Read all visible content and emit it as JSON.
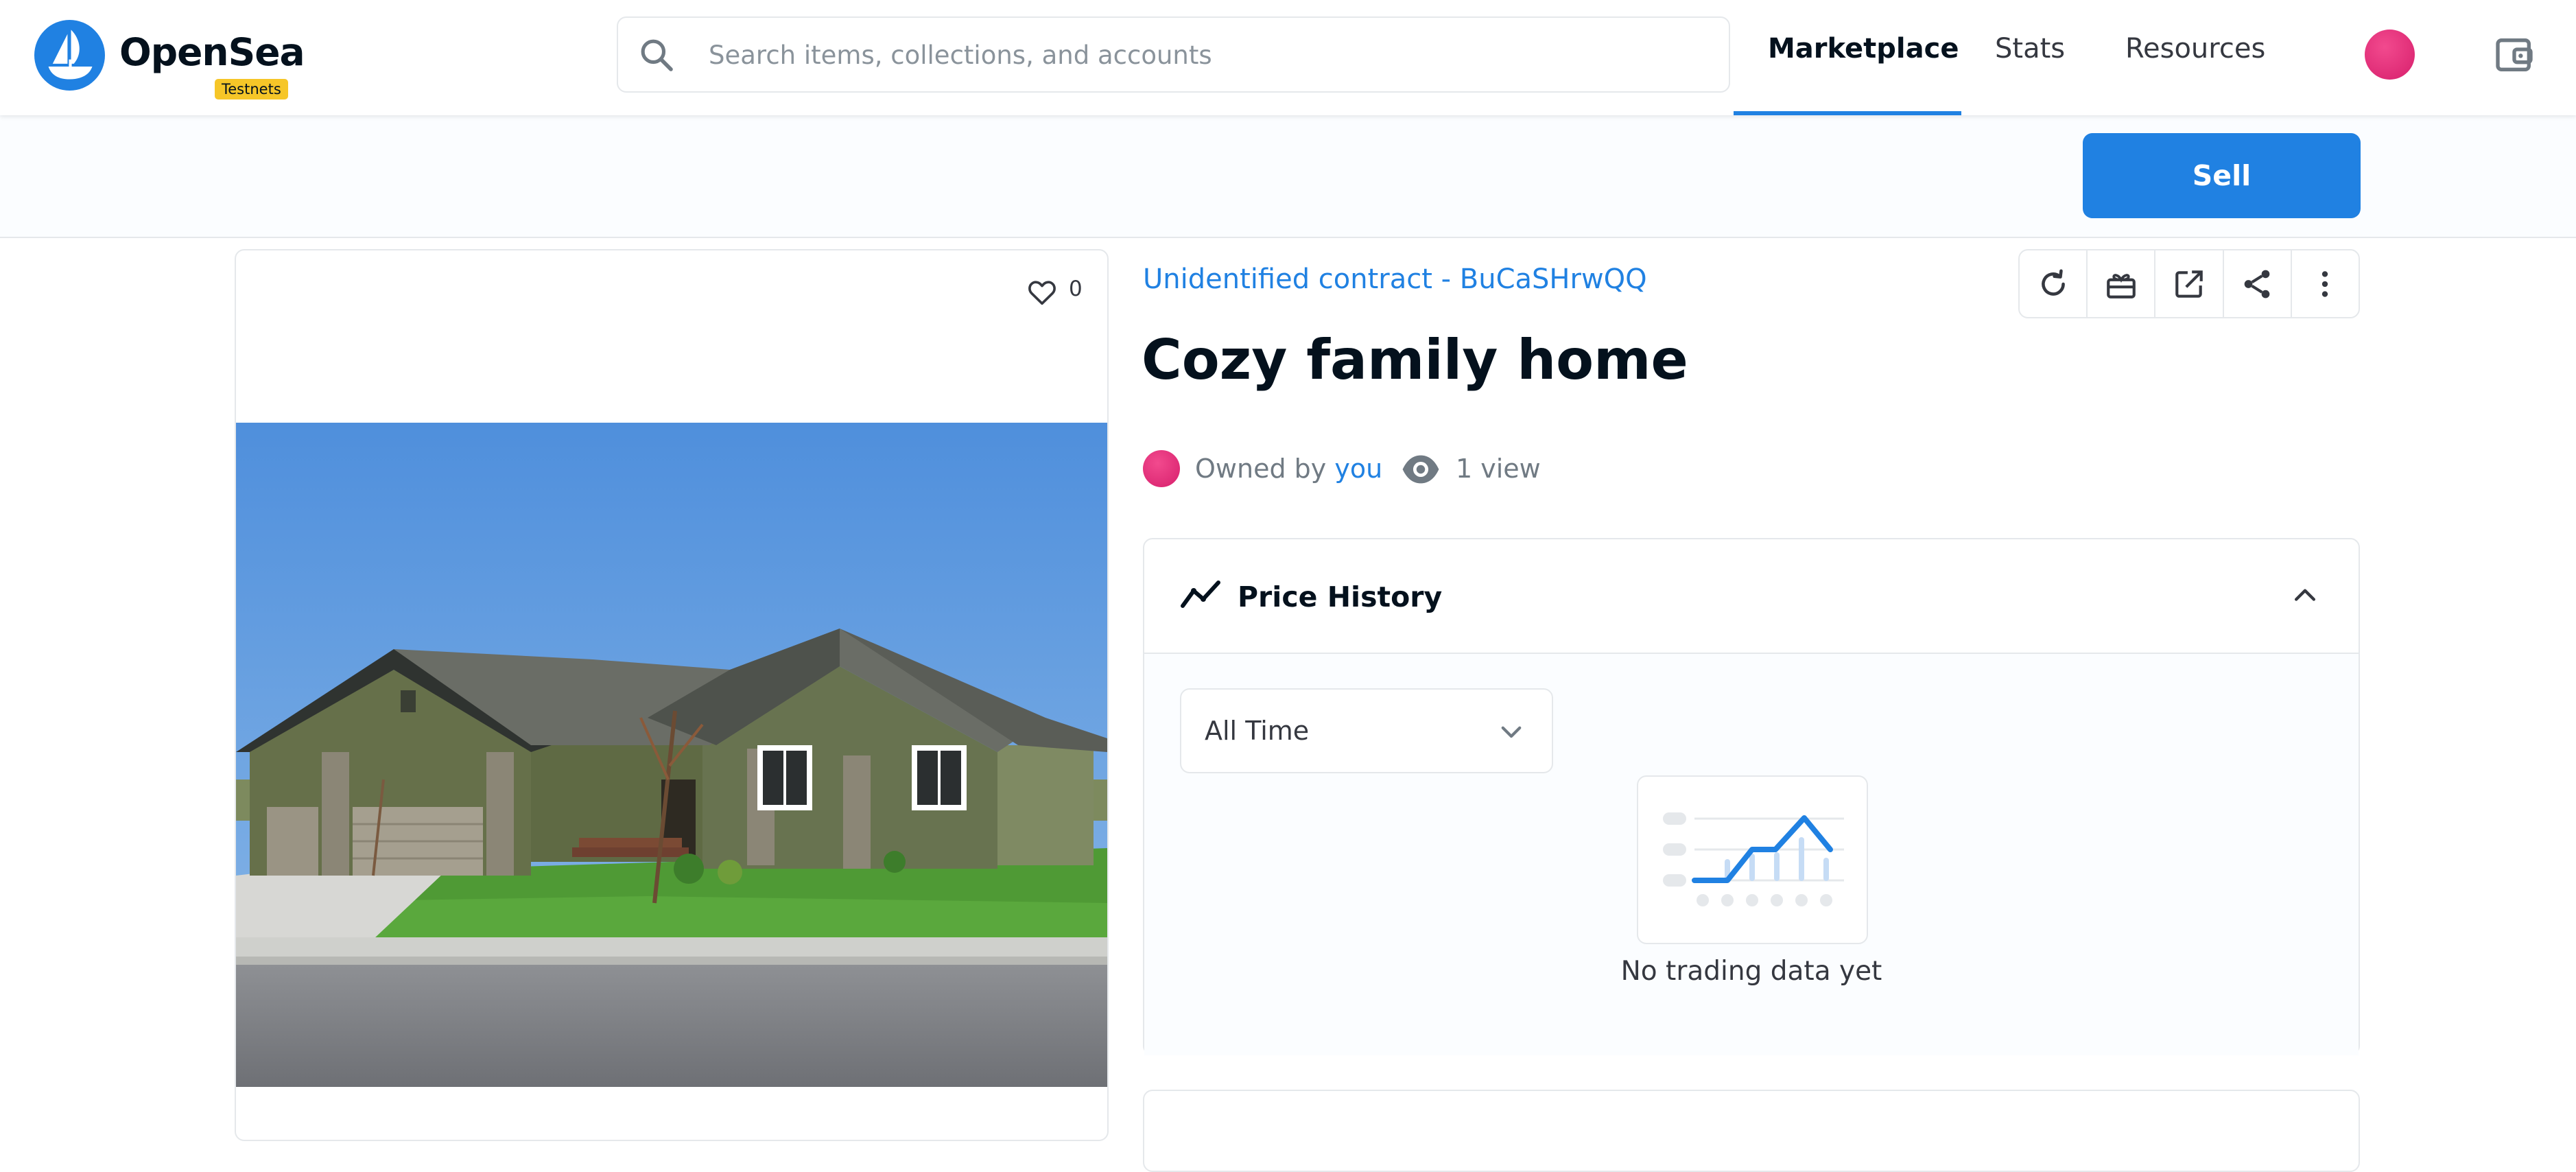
{
  "header": {
    "logo_text": "OpenSea",
    "badge": "Testnets",
    "search": {
      "placeholder": "Search items, collections, and accounts",
      "value": ""
    },
    "nav": [
      {
        "label": "Marketplace",
        "active": true
      },
      {
        "label": "Stats",
        "active": false
      },
      {
        "label": "Resources",
        "active": false
      }
    ],
    "icons": [
      "opensea-logo-icon",
      "search-icon",
      "avatar",
      "wallet-icon"
    ]
  },
  "sell_bar": {
    "sell_label": "Sell"
  },
  "item": {
    "favorites": "0",
    "image_alt": "Suburban house with gray roof and green lawn",
    "collection": "Unidentified contract - BuCaSHrwQQ",
    "title": "Cozy family home",
    "owned_by_prefix": "Owned by",
    "owner": "you",
    "views": "1 view"
  },
  "toolbar_icons": [
    "refresh-icon",
    "transfer-icon",
    "external-link-icon",
    "share-icon",
    "more-icon"
  ],
  "price_history": {
    "title": "Price History",
    "range": "All Time",
    "empty_text": "No trading data yet"
  },
  "colors": {
    "accent": "#2081e2",
    "badge": "#f6c628",
    "avatar": "#e2327c",
    "border": "#e5e8eb",
    "text": "#04111d",
    "muted": "#707a83"
  }
}
